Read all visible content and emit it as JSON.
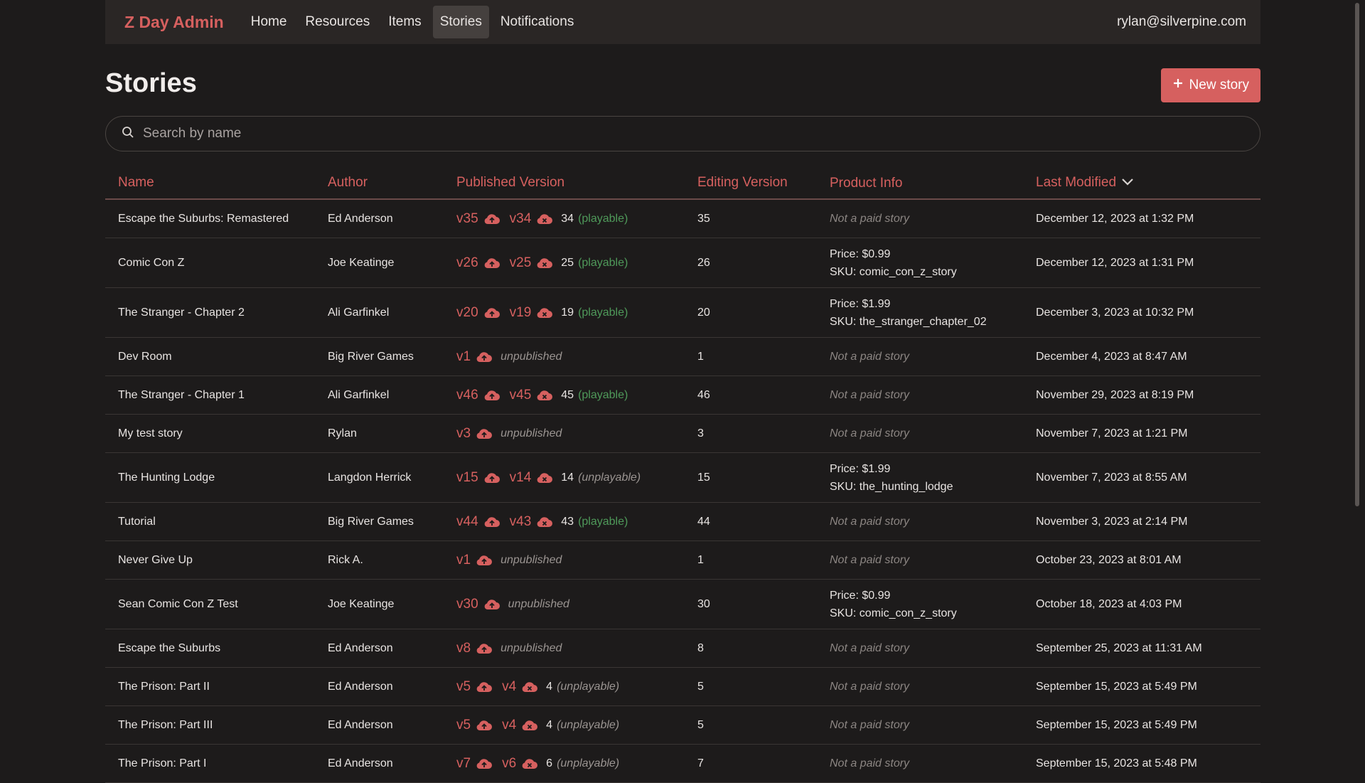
{
  "nav": {
    "brand": "Z Day Admin",
    "links": [
      "Home",
      "Resources",
      "Items",
      "Stories",
      "Notifications"
    ],
    "user": "rylan@silverpine.com"
  },
  "page": {
    "title": "Stories",
    "new_button": "New story"
  },
  "search": {
    "placeholder": "Search by name",
    "value": ""
  },
  "table": {
    "headers": [
      "Name",
      "Author",
      "Published Version",
      "Editing Version",
      "Product Info",
      "Last Modified"
    ],
    "rows": [
      {
        "name": "Escape the Suburbs: Remastered",
        "author": "Ed Anderson",
        "v1": "v35",
        "v2": "v34",
        "num": "34",
        "status": "(playable)",
        "edit": "35",
        "price": "",
        "sku": "",
        "modified": "December 12, 2023 at 1:32 PM"
      },
      {
        "name": "Comic Con Z",
        "author": "Joe Keatinge",
        "v1": "v26",
        "v2": "v25",
        "num": "25",
        "status": "(playable)",
        "edit": "26",
        "price": "Price: $0.99",
        "sku": "SKU: comic_con_z_story",
        "modified": "December 12, 2023 at 1:31 PM"
      },
      {
        "name": "The Stranger - Chapter 2",
        "author": "Ali Garfinkel",
        "v1": "v20",
        "v2": "v19",
        "num": "19",
        "status": "(playable)",
        "edit": "20",
        "price": "Price: $1.99",
        "sku": "SKU: the_stranger_chapter_02",
        "modified": "December 3, 2023 at 10:32 PM"
      },
      {
        "name": "Dev Room",
        "author": "Big River Games",
        "v1": "v1",
        "v2": "",
        "num": "",
        "status": "unpublished",
        "edit": "1",
        "price": "",
        "sku": "",
        "modified": "December 4, 2023 at 8:47 AM"
      },
      {
        "name": "The Stranger - Chapter 1",
        "author": "Ali Garfinkel",
        "v1": "v46",
        "v2": "v45",
        "num": "45",
        "status": "(playable)",
        "edit": "46",
        "price": "",
        "sku": "",
        "modified": "November 29, 2023 at 8:19 PM"
      },
      {
        "name": "My test story",
        "author": "Rylan",
        "v1": "v3",
        "v2": "",
        "num": "",
        "status": "unpublished",
        "edit": "3",
        "price": "",
        "sku": "",
        "modified": "November 7, 2023 at 1:21 PM"
      },
      {
        "name": "The Hunting Lodge",
        "author": "Langdon Herrick",
        "v1": "v15",
        "v2": "v14",
        "num": "14",
        "status": "(unplayable)",
        "edit": "15",
        "price": "Price: $1.99",
        "sku": "SKU: the_hunting_lodge",
        "modified": "November 7, 2023 at 8:55 AM"
      },
      {
        "name": "Tutorial",
        "author": "Big River Games",
        "v1": "v44",
        "v2": "v43",
        "num": "43",
        "status": "(playable)",
        "edit": "44",
        "price": "",
        "sku": "",
        "modified": "November 3, 2023 at 2:14 PM"
      },
      {
        "name": "Never Give Up",
        "author": "Rick A.",
        "v1": "v1",
        "v2": "",
        "num": "",
        "status": "unpublished",
        "edit": "1",
        "price": "",
        "sku": "",
        "modified": "October 23, 2023 at 8:01 AM"
      },
      {
        "name": "Sean Comic Con Z Test",
        "author": "Joe Keatinge",
        "v1": "v30",
        "v2": "",
        "num": "",
        "status": "unpublished",
        "edit": "30",
        "price": "Price: $0.99",
        "sku": "SKU: comic_con_z_story",
        "modified": "October 18, 2023 at 4:03 PM"
      },
      {
        "name": "Escape the Suburbs",
        "author": "Ed Anderson",
        "v1": "v8",
        "v2": "",
        "num": "",
        "status": "unpublished",
        "edit": "8",
        "price": "",
        "sku": "",
        "modified": "September 25, 2023 at 11:31 AM"
      },
      {
        "name": "The Prison: Part II",
        "author": "Ed Anderson",
        "v1": "v5",
        "v2": "v4",
        "num": "4",
        "status": "(unplayable)",
        "edit": "5",
        "price": "",
        "sku": "",
        "modified": "September 15, 2023 at 5:49 PM"
      },
      {
        "name": "The Prison: Part III",
        "author": "Ed Anderson",
        "v1": "v5",
        "v2": "v4",
        "num": "4",
        "status": "(unplayable)",
        "edit": "5",
        "price": "",
        "sku": "",
        "modified": "September 15, 2023 at 5:49 PM"
      },
      {
        "name": "The Prison: Part I",
        "author": "Ed Anderson",
        "v1": "v7",
        "v2": "v6",
        "num": "6",
        "status": "(unplayable)",
        "edit": "7",
        "price": "",
        "sku": "",
        "modified": "September 15, 2023 at 5:48 PM"
      }
    ],
    "not_paid_label": "Not a paid story"
  },
  "colors": {
    "accent": "#d6605f",
    "playable": "#4f9a5a",
    "background": "#1d1b1b",
    "nav_bg": "#2a2625"
  },
  "icons": {
    "publish": "cloud-upload-icon",
    "unpublish": "cloud-x-icon",
    "search": "search-icon",
    "plus": "plus-icon",
    "sort": "chevron-down-icon"
  }
}
